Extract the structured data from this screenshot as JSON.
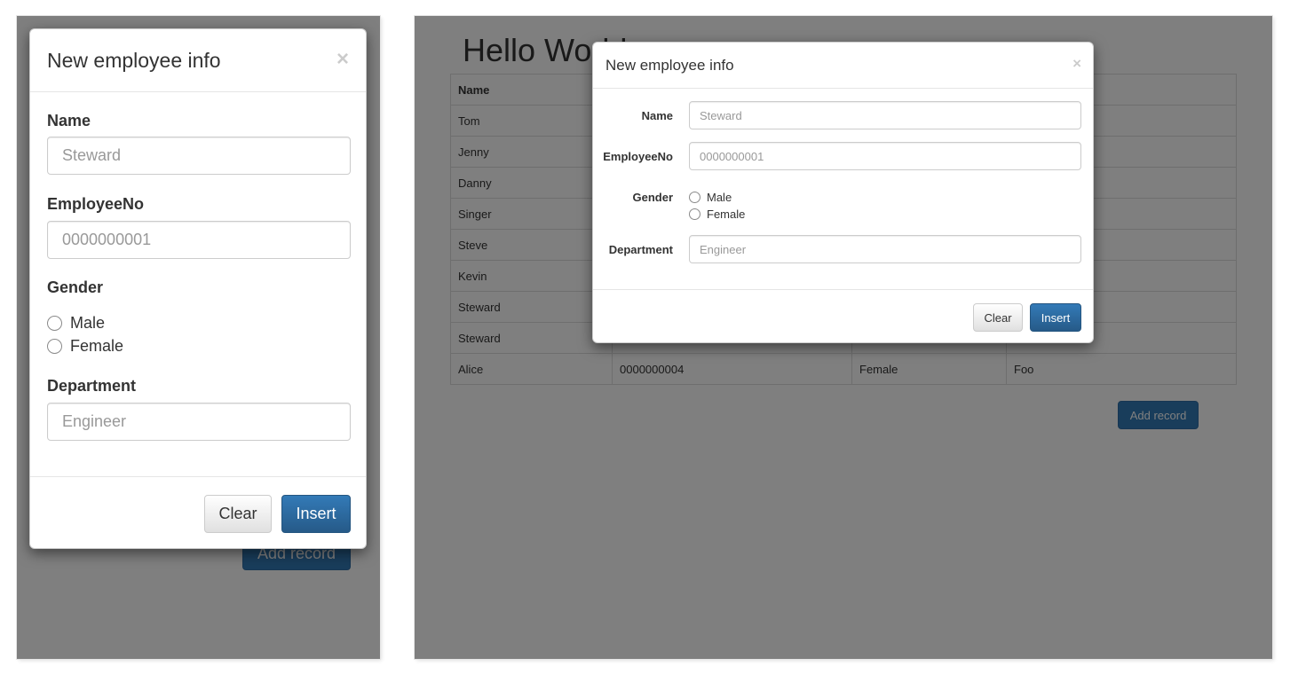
{
  "modal": {
    "title": "New employee info",
    "close_symbol": "×",
    "name_label": "Name",
    "name_placeholder": "Steward",
    "employee_no_label": "EmployeeNo",
    "employee_no_placeholder": "0000000001",
    "gender_label": "Gender",
    "gender_options": [
      "Male",
      "Female"
    ],
    "department_label": "Department",
    "department_placeholder": "Engineer",
    "clear_label": "Clear",
    "insert_label": "Insert"
  },
  "page": {
    "heading": "Hello World",
    "add_record_label": "Add record",
    "table": {
      "headers": [
        "Name",
        "",
        "",
        ""
      ],
      "rows": [
        [
          "Tom",
          "",
          "",
          ""
        ],
        [
          "Jenny",
          "",
          "",
          ""
        ],
        [
          "Danny",
          "",
          "",
          ""
        ],
        [
          "Singer",
          "",
          "",
          ""
        ],
        [
          "Steve",
          "",
          "",
          ""
        ],
        [
          "Kevin",
          "",
          "",
          ""
        ],
        [
          "Steward",
          "",
          "",
          ""
        ],
        [
          "Steward",
          "",
          "",
          ""
        ],
        [
          "Alice",
          "0000000004",
          "Female",
          "Foo"
        ]
      ]
    }
  },
  "colors": {
    "primary": "#337ab7",
    "backdrop": "rgba(0,0,0,0.5)"
  }
}
